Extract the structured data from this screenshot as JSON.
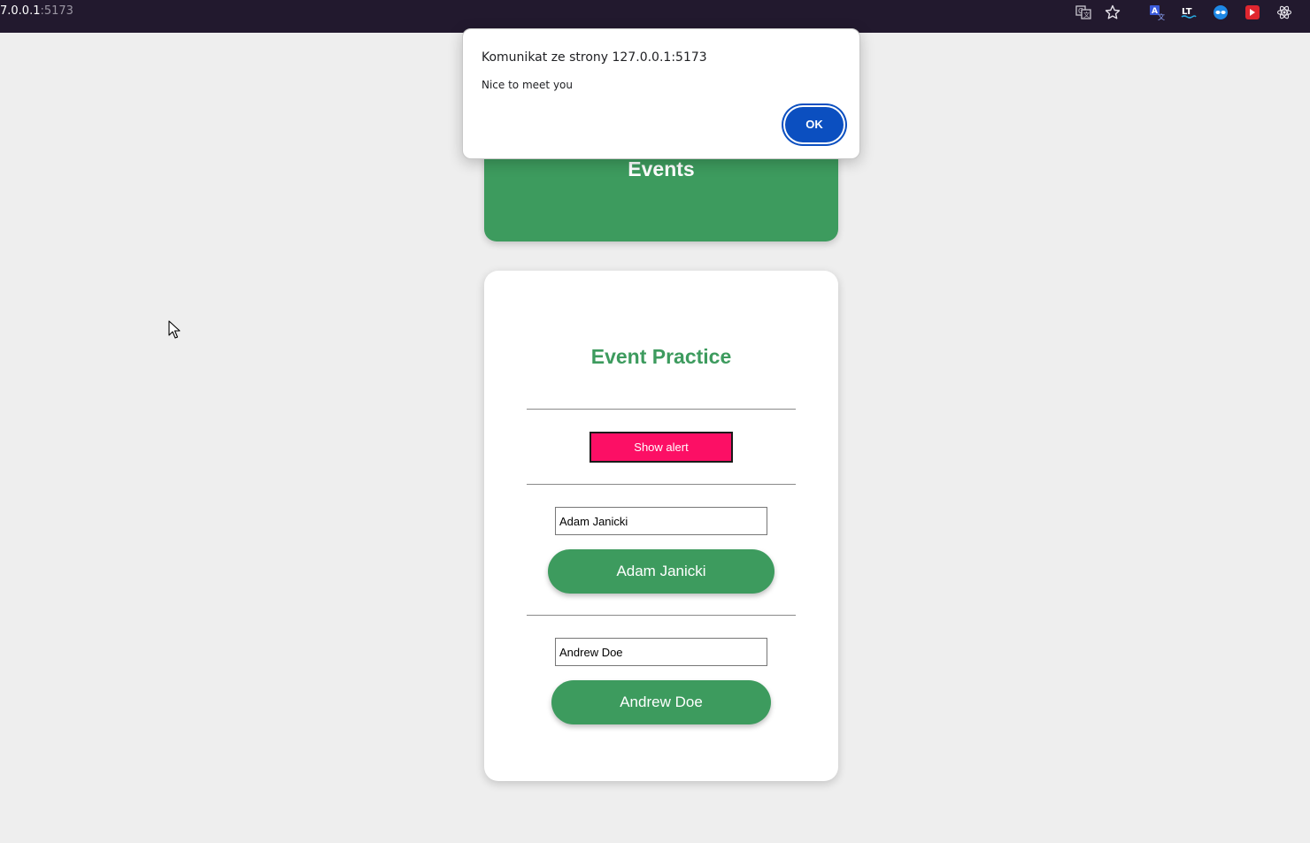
{
  "browser": {
    "url_host": "7.0.0.1",
    "url_port": ":5173",
    "toolbar_icons": [
      "translate-icon",
      "bookmark-star-icon",
      "extension-translate-icon",
      "extension-lt-icon",
      "extension-mask-icon",
      "extension-red-play-icon",
      "react-devtools-icon"
    ],
    "colors": {
      "chrome_bg": "#22192e"
    }
  },
  "dialog": {
    "title": "Komunikat ze strony 127.0.0.1:5173",
    "message": "Nice to meet you",
    "ok_label": "OK",
    "colors": {
      "ok_bg": "#0b4fc0"
    }
  },
  "header": {
    "title": "Events"
  },
  "card": {
    "title": "Event Practice",
    "alert_button_label": "Show alert",
    "first_input_value": "Adam Janicki",
    "first_button_label": "Adam Janicki",
    "second_input_value": "Andrew Doe",
    "second_button_label": "Andrew Doe"
  },
  "colors": {
    "accent_green": "#3d9b5e",
    "alert_pink": "#fc0f65",
    "page_bg": "#eeeeee"
  }
}
